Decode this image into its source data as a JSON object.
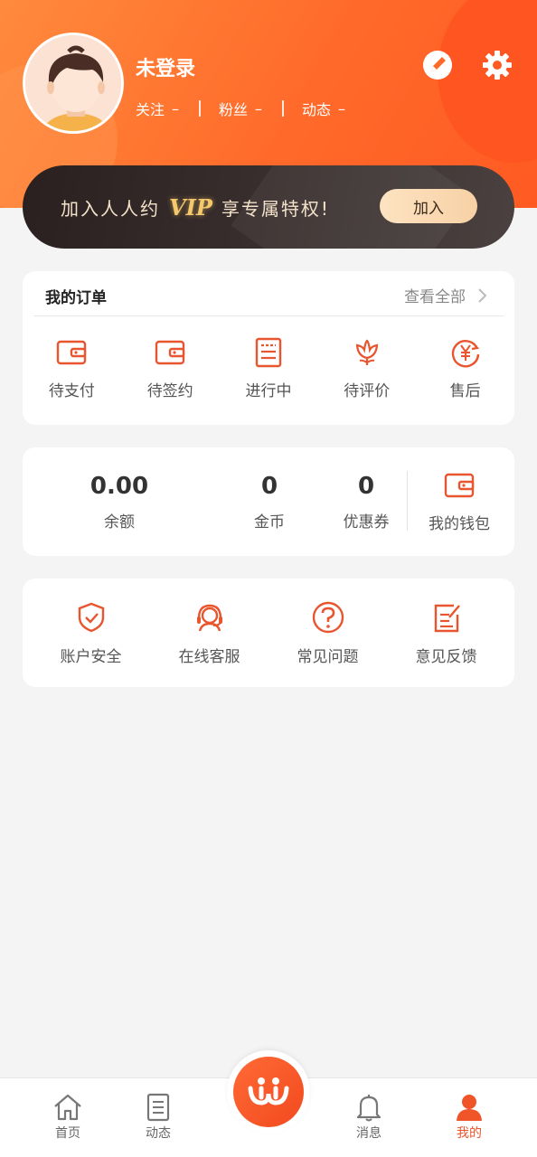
{
  "profile": {
    "username": "未登录",
    "stats": [
      {
        "label": "关注",
        "value": "–"
      },
      {
        "label": "粉丝",
        "value": "–"
      },
      {
        "label": "动态",
        "value": "–"
      }
    ]
  },
  "vip": {
    "text_before": "加入人人约",
    "badge": "VIP",
    "text_after": "享专属特权!",
    "join_label": "加入"
  },
  "orders": {
    "title": "我的订单",
    "view_all": "查看全部",
    "items": [
      {
        "label": "待支付",
        "icon": "wallet-icon"
      },
      {
        "label": "待签约",
        "icon": "wallet-icon"
      },
      {
        "label": "进行中",
        "icon": "list-document-icon"
      },
      {
        "label": "待评价",
        "icon": "flower-icon"
      },
      {
        "label": "售后",
        "icon": "yen-refresh-icon"
      }
    ]
  },
  "wallet": {
    "balance": {
      "value": "0.00",
      "label": "余额"
    },
    "coins": {
      "value": "0",
      "label": "金币"
    },
    "coupons": {
      "value": "0",
      "label": "优惠券"
    },
    "my_wallet": "我的钱包"
  },
  "services": {
    "items": [
      {
        "label": "账户安全",
        "icon": "shield-check-icon"
      },
      {
        "label": "在线客服",
        "icon": "headset-icon"
      },
      {
        "label": "常见问题",
        "icon": "question-icon"
      },
      {
        "label": "意见反馈",
        "icon": "feedback-edit-icon"
      }
    ]
  },
  "tabbar": {
    "items": [
      {
        "label": "首页",
        "icon": "home-icon"
      },
      {
        "label": "动态",
        "icon": "document-icon"
      },
      {
        "label": "",
        "icon": "app-logo-icon"
      },
      {
        "label": "消息",
        "icon": "bell-icon"
      },
      {
        "label": "我的",
        "icon": "person-icon",
        "active": true
      }
    ]
  },
  "colors": {
    "accent": "#f0552a",
    "header": "#ff6a2a",
    "vip_bg": "#2a2020",
    "vip_gold": "#f5c86b"
  }
}
